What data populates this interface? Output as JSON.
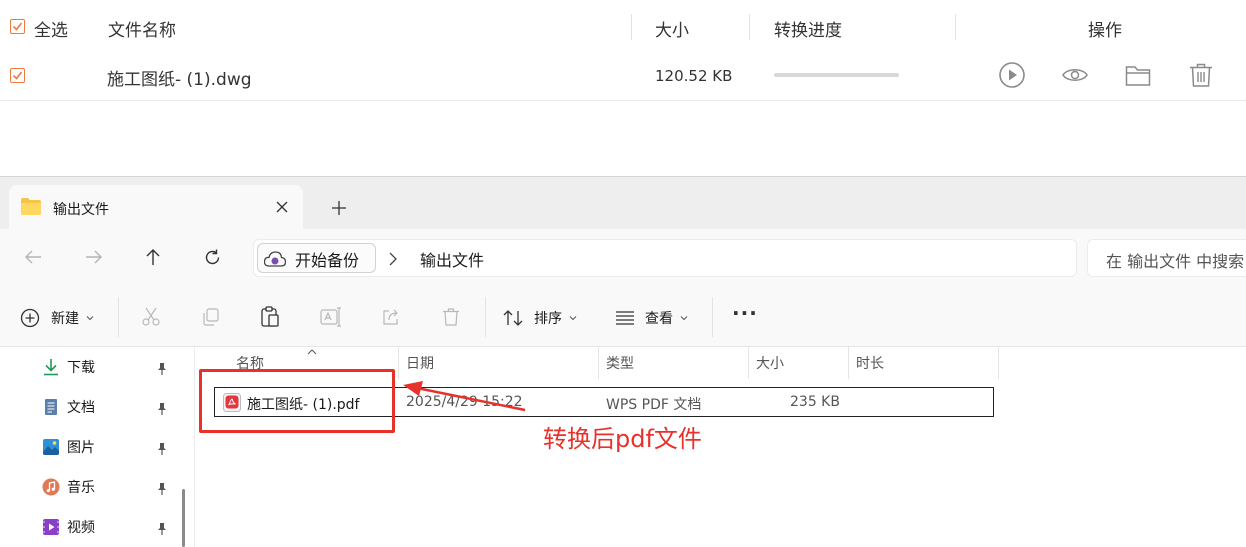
{
  "converter": {
    "header": {
      "select_all": "全选",
      "file_name": "文件名称",
      "size": "大小",
      "progress": "转换进度",
      "actions": "操作"
    },
    "rows": [
      {
        "name": "施工图纸- (1).dwg",
        "size": "120.52 KB",
        "progress": 0,
        "checked": true
      }
    ],
    "accent_color": "#f07a3d"
  },
  "explorer": {
    "tab_title": "输出文件",
    "breadcrumb": {
      "root": "开始备份",
      "current": "输出文件"
    },
    "search_placeholder": "在 输出文件 中搜索",
    "commands": {
      "new": "新建",
      "sort": "排序",
      "view": "查看",
      "more": "···"
    },
    "sidebar": [
      {
        "label": "下载",
        "icon": "download-icon"
      },
      {
        "label": "文档",
        "icon": "document-icon"
      },
      {
        "label": "图片",
        "icon": "picture-icon"
      },
      {
        "label": "音乐",
        "icon": "music-icon"
      },
      {
        "label": "视频",
        "icon": "video-icon"
      }
    ],
    "columns": {
      "name": "名称",
      "date": "日期",
      "type": "类型",
      "size": "大小",
      "duration": "时长"
    },
    "files": [
      {
        "name": "施工图纸- (1).pdf",
        "date": "2025/4/29 15:22",
        "type": "WPS PDF 文档",
        "size": "235 KB",
        "duration": ""
      }
    ]
  },
  "annotation": {
    "label": "转换后pdf文件",
    "color": "#e8312b"
  }
}
